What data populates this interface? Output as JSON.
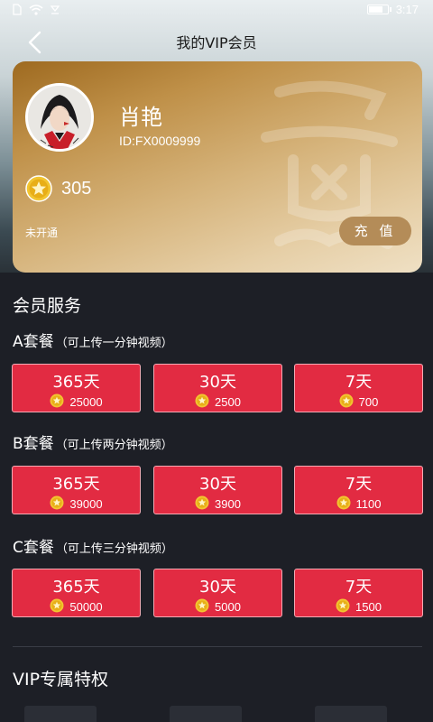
{
  "status_bar": {
    "time": "3:17"
  },
  "nav": {
    "title": "我的VIP会员"
  },
  "card": {
    "username": "肖艳",
    "user_id": "ID:FX0009999",
    "coins": "305",
    "vip_status": "未开通",
    "recharge_label": "充 值"
  },
  "service": {
    "title": "会员服务",
    "packages": [
      {
        "name": "A套餐",
        "note": "（可上传一分钟视频）",
        "options": [
          {
            "days": "365天",
            "price": "25000"
          },
          {
            "days": "30天",
            "price": "2500"
          },
          {
            "days": "7天",
            "price": "700"
          }
        ]
      },
      {
        "name": "B套餐",
        "note": "（可上传两分钟视频）",
        "options": [
          {
            "days": "365天",
            "price": "39000"
          },
          {
            "days": "30天",
            "price": "3900"
          },
          {
            "days": "7天",
            "price": "1100"
          }
        ]
      },
      {
        "name": "C套餐",
        "note": "（可上传三分钟视频）",
        "options": [
          {
            "days": "365天",
            "price": "50000"
          },
          {
            "days": "30天",
            "price": "5000"
          },
          {
            "days": "7天",
            "price": "1500"
          }
        ]
      }
    ]
  },
  "privileges": {
    "title": "VIP专属特权"
  },
  "colors": {
    "tile": "#e22b42",
    "card_gold": "#c9a060",
    "background": "#1d1f26",
    "recharge": "#b48c58"
  },
  "icons": [
    "sim-icon",
    "wifi-icon",
    "signal-icon",
    "battery-icon",
    "back-icon",
    "coin-star-icon"
  ]
}
